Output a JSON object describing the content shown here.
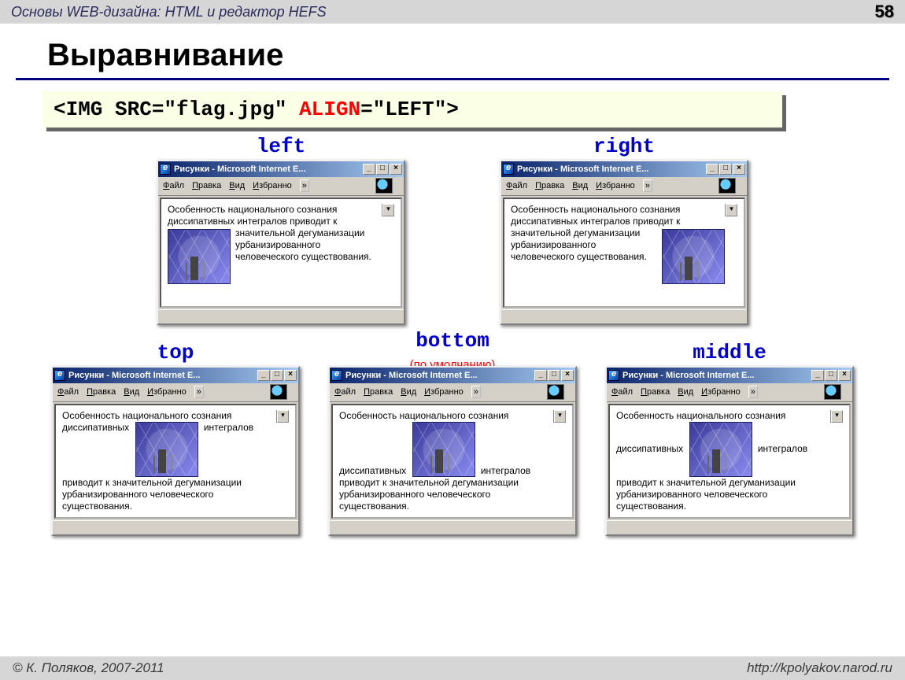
{
  "header": {
    "breadcrumb": "Основы WEB-дизайна: HTML и редактор HEFS",
    "page_number": "58"
  },
  "title": "Выравнивание",
  "code": {
    "before": "<IMG SRC=\"flag.jpg\" ",
    "attr": "ALIGN",
    "after": "=\"LEFT\">"
  },
  "sample_text": {
    "full": "Особенность национального сознания диссипативных интегралов приводит к значительной дегуманизации урбанизированного человеческого существования.",
    "part1": "Особенность национального сознания диссипативных интегралов приводит к",
    "part2": "значительной дегуманизации урбанизированного человеческого существования.",
    "top_before": "Особенность национального сознания диссипативных",
    "top_after": "интегралов",
    "top_rest": "приводит к значительной дегуманизации урбанизированного человеческого существования.",
    "bot_before": "Особенность национального сознания",
    "bot_mid1": "диссипативных",
    "bot_mid2": "интегралов",
    "bot_rest": "приводит к значительной дегуманизации урбанизированного человеческого существования.",
    "mid_before": "Особенность национального сознания",
    "mid_mid1": "диссипативных",
    "mid_mid2": "интегралов",
    "mid_rest": "приводит к значительной дегуманизации урбанизированного человеческого существования."
  },
  "windows": {
    "title_text": "Рисунки - Microsoft Internet E...",
    "menu": {
      "file": "Файл",
      "edit": "Правка",
      "view": "Вид",
      "fav": "Избранно"
    },
    "labels": {
      "left": "left",
      "right": "right",
      "top": "top",
      "bottom": "bottom",
      "bottom_sub": "(по умолчанию)",
      "middle": "middle"
    }
  },
  "footer": {
    "left": "© К. Поляков, 2007-2011",
    "right": "http://kpolyakov.narod.ru"
  }
}
